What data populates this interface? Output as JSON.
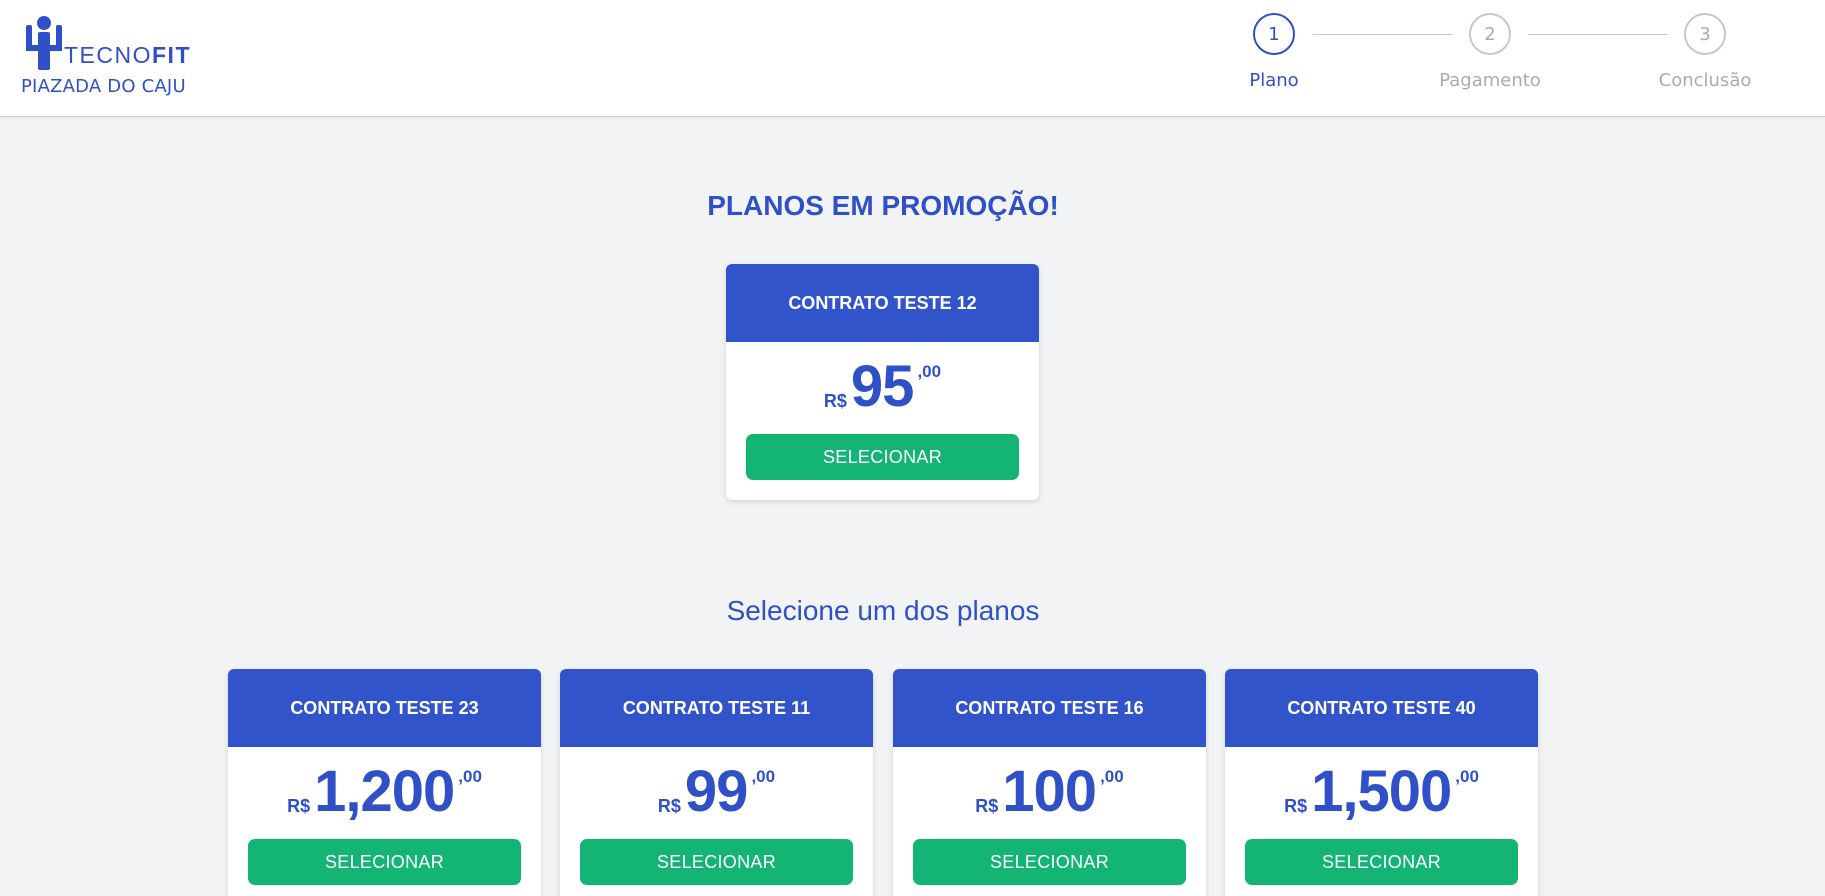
{
  "header": {
    "brand_light": "TECNO",
    "brand_bold": "FIT",
    "gym_name": "PIAZADA DO CAJU",
    "steps": [
      {
        "number": "1",
        "label": "Plano",
        "state": "active"
      },
      {
        "number": "2",
        "label": "Pagamento",
        "state": "inactive"
      },
      {
        "number": "3",
        "label": "Conclusão",
        "state": "inactive"
      }
    ]
  },
  "promo": {
    "title": "PLANOS EM PROMOÇÃO!",
    "plan": {
      "name": "CONTRATO TESTE 12",
      "currency": "R$",
      "integer": "95",
      "cents": ",00",
      "button": "SELECIONAR"
    }
  },
  "plans": {
    "title": "Selecione um dos planos",
    "items": [
      {
        "name": "CONTRATO TESTE 23",
        "currency": "R$",
        "integer": "1,200",
        "cents": ",00",
        "button": "SELECIONAR"
      },
      {
        "name": "CONTRATO TESTE 11",
        "currency": "R$",
        "integer": "99",
        "cents": ",00",
        "button": "SELECIONAR"
      },
      {
        "name": "CONTRATO TESTE 16",
        "currency": "R$",
        "integer": "100",
        "cents": ",00",
        "button": "SELECIONAR"
      },
      {
        "name": "CONTRATO TESTE 40",
        "currency": "R$",
        "integer": "1,500",
        "cents": ",00",
        "button": "SELECIONAR"
      }
    ]
  },
  "colors": {
    "primary": "#3254cb",
    "success": "#14b574",
    "background": "#f2f3f5",
    "inactive": "#a8acb2"
  }
}
